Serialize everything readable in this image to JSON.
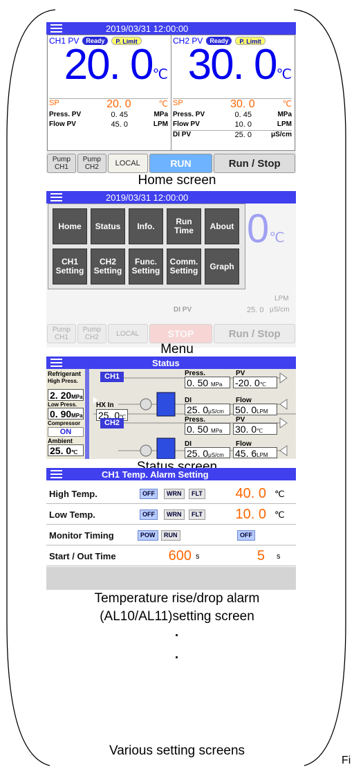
{
  "home": {
    "datetime": "2019/03/31    12:00:00",
    "ch1": {
      "label": "CH1 PV",
      "status": "Ready",
      "limit": "P. Limit",
      "temp": "20. 0",
      "temp_unit": "℃",
      "sp_label": "SP",
      "sp": "20. 0",
      "sp_unit": "℃",
      "press_label": "Press. PV",
      "press": "0. 45",
      "press_unit": "MPa",
      "flow_label": "Flow PV",
      "flow": "45. 0",
      "flow_unit": "LPM"
    },
    "ch2": {
      "label": "CH2 PV",
      "status": "Ready",
      "limit": "P. Limit",
      "temp": "30. 0",
      "temp_unit": "℃",
      "sp_label": "SP",
      "sp": "30. 0",
      "sp_unit": "℃",
      "press_label": "Press. PV",
      "press": "0. 45",
      "press_unit": "MPa",
      "flow_label": "Flow PV",
      "flow": "10. 0",
      "flow_unit": "LPM",
      "di_label": "DI PV",
      "di": "25. 0",
      "di_unit": "μS/cm"
    },
    "buttons": {
      "pump1": "Pump CH1",
      "pump2": "Pump CH2",
      "local": "LOCAL",
      "run": "RUN",
      "runstop": "Run / Stop"
    },
    "caption": "Home screen"
  },
  "menu": {
    "datetime": "2019/03/31    12:00:00",
    "items": [
      "Home",
      "Status",
      "Info.",
      "Run Time",
      "About",
      "CH1 Setting",
      "CH2 Setting",
      "Func. Setting",
      "Comm. Setting",
      "Graph"
    ],
    "bg": {
      "di_label": "DI PV",
      "di": "25. 0",
      "di_unit": "μS/cm",
      "unit1": "℃",
      "unit2": "LPM",
      "pump1": "Pump CH1",
      "pump2": "Pump CH2",
      "local": "LOCAL",
      "stop": "STOP",
      "runstop": "Run / Stop"
    },
    "caption": "Menu"
  },
  "status": {
    "title": "Status",
    "refrigerant": "Refrigerant",
    "high_press": "High Press.",
    "high_val": "2. 20",
    "low_press": "Low Press.",
    "low_val": "0. 90",
    "press_unit": "MPa",
    "compressor": "Compressor",
    "comp_state": "ON",
    "ambient": "Ambient",
    "ambient_val": "25. 0",
    "hx_label": "HX In",
    "hx_val": "25. 0",
    "temp_unit": "℃",
    "ch1": {
      "tag": "CH1",
      "press_label": "Press.",
      "press": "0. 50",
      "press_unit": "MPa",
      "pv_label": "PV",
      "pv": "-20. 0",
      "di_label": "DI",
      "di": "25. 0",
      "di_unit": "μS/cm",
      "flow_label": "Flow",
      "flow": "50. 0",
      "flow_unit": "LPM"
    },
    "ch2": {
      "tag": "CH2",
      "press_label": "Press.",
      "press": "0. 50",
      "press_unit": "MPa",
      "pv_label": "PV",
      "pv": "30. 0",
      "di_label": "DI",
      "di": "25. 0",
      "di_unit": "μS/cm",
      "flow_label": "Flow",
      "flow": "45. 6",
      "flow_unit": "LPM"
    },
    "caption": "Status screen"
  },
  "alarm": {
    "title": "CH1 Temp. Alarm Setting",
    "rows": [
      {
        "label": "High Temp.",
        "t1": "OFF",
        "t2": "WRN",
        "t3": "FLT",
        "value": "40. 0",
        "unit": "℃"
      },
      {
        "label": "Low Temp.",
        "t1": "OFF",
        "t2": "WRN",
        "t3": "FLT",
        "value": "10. 0",
        "unit": "℃"
      },
      {
        "label": "Monitor Timing",
        "t1": "POW",
        "t2": "RUN",
        "t3": "OFF"
      },
      {
        "label": "Start / Out Time",
        "v1": "600",
        "u1": "s",
        "v2": "5",
        "u2": "s"
      }
    ],
    "caption1": "Temperature rise/drop alarm",
    "caption2": "(AL10/AL11)setting screen",
    "dot": "·",
    "caption3": "Various setting screens"
  },
  "fig": "Fi"
}
